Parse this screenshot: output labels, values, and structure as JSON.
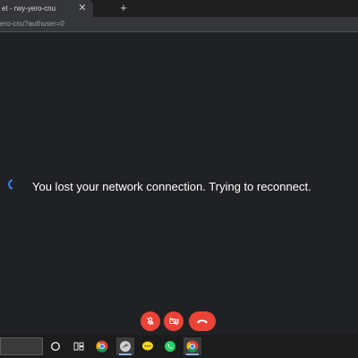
{
  "browser": {
    "tab_title": "et - rwy-yero-cnu",
    "tab_close_glyph": "✕",
    "new_tab_glyph": "+",
    "url": "ero-cnu?authuser=0"
  },
  "meet": {
    "status_message": "You lost your network connection. Trying to reconnect.",
    "accent_color": "#ea4335"
  },
  "taskbar": {
    "icons": [
      "search-box",
      "cortana-icon",
      "task-view-icon",
      "chrome-icon",
      "app-icon",
      "chat-icon",
      "whatsapp-icon",
      "chrome-active-icon"
    ]
  }
}
